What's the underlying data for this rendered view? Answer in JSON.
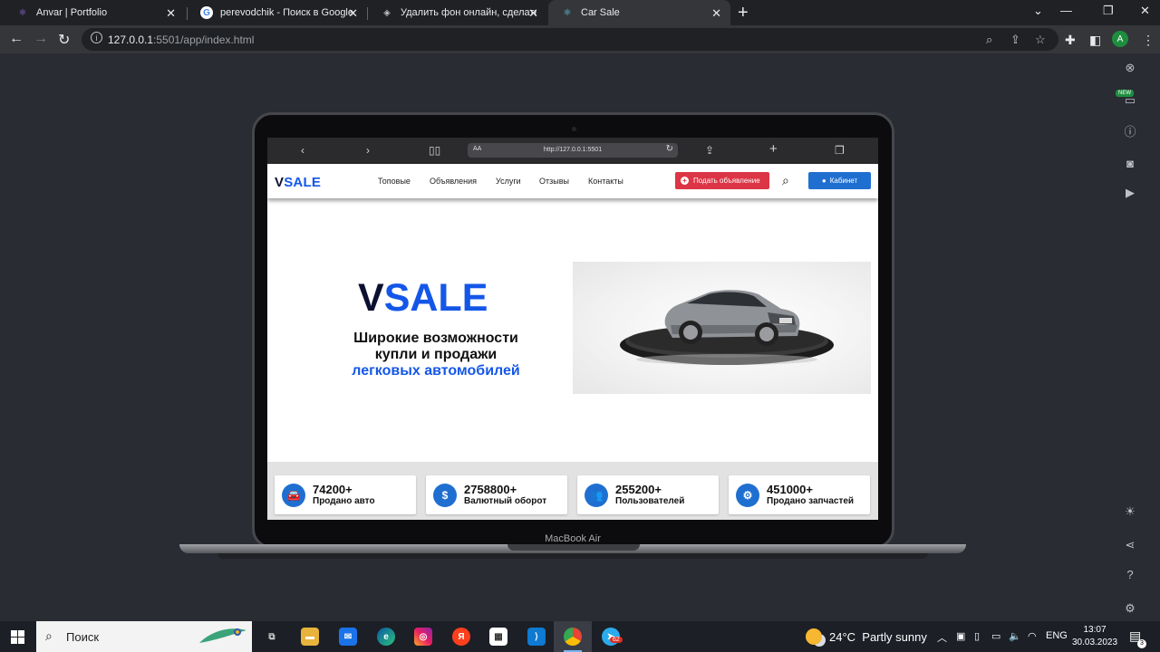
{
  "browser": {
    "tabs": [
      {
        "title": "Anvar | Portfolio",
        "icon": "react-icon"
      },
      {
        "title": "perevodchik - Поиск в Google",
        "icon": "google-icon"
      },
      {
        "title": "Удалить фон онлайн, сделать п",
        "icon": "layers-icon"
      },
      {
        "title": "Car Sale",
        "icon": "react-icon",
        "active": true
      }
    ],
    "url_host": "127.0.0.1",
    "url_rest": ":5501/app/index.html"
  },
  "device": {
    "label": "MacBook Air",
    "safari_aa": "AA",
    "safari_url": "http://127.0.0.1:5501"
  },
  "site": {
    "logo_v": "V",
    "logo_sale": "SALE",
    "nav": [
      "Топовые",
      "Объявления",
      "Услуги",
      "Отзывы",
      "Контакты"
    ],
    "post_button": "Подать объявление",
    "cabinet_button": "Кабинет",
    "hero": {
      "logo_v": "V",
      "logo_sale": "SALE",
      "line1": "Широкие возможности",
      "line2": "купли и продажи",
      "line3": "легковых автомобилей"
    },
    "stats": [
      {
        "value": "74200+",
        "label": "Продано авто",
        "icon": "car-icon"
      },
      {
        "value": "2758800+",
        "label": "Валютный оборот",
        "icon": "dollar-icon"
      },
      {
        "value": "255200+",
        "label": "Пользователей",
        "icon": "users-icon"
      },
      {
        "value": "451000+",
        "label": "Продано запчастей",
        "icon": "gear-icon"
      }
    ]
  },
  "sidebar": {
    "new_badge": "NEW"
  },
  "taskbar": {
    "search_label": "Поиск",
    "telegram_badge": "62",
    "weather_temp": "24°C",
    "weather_text": "Partly sunny",
    "lang": "ENG",
    "time": "13:07",
    "date": "30.03.2023",
    "notif_count": "3"
  },
  "colors": {
    "brand_blue": "#1457e8",
    "brand_dark": "#0d1130",
    "post_red": "#dc3545",
    "cabinet_blue": "#1f6fd1"
  }
}
